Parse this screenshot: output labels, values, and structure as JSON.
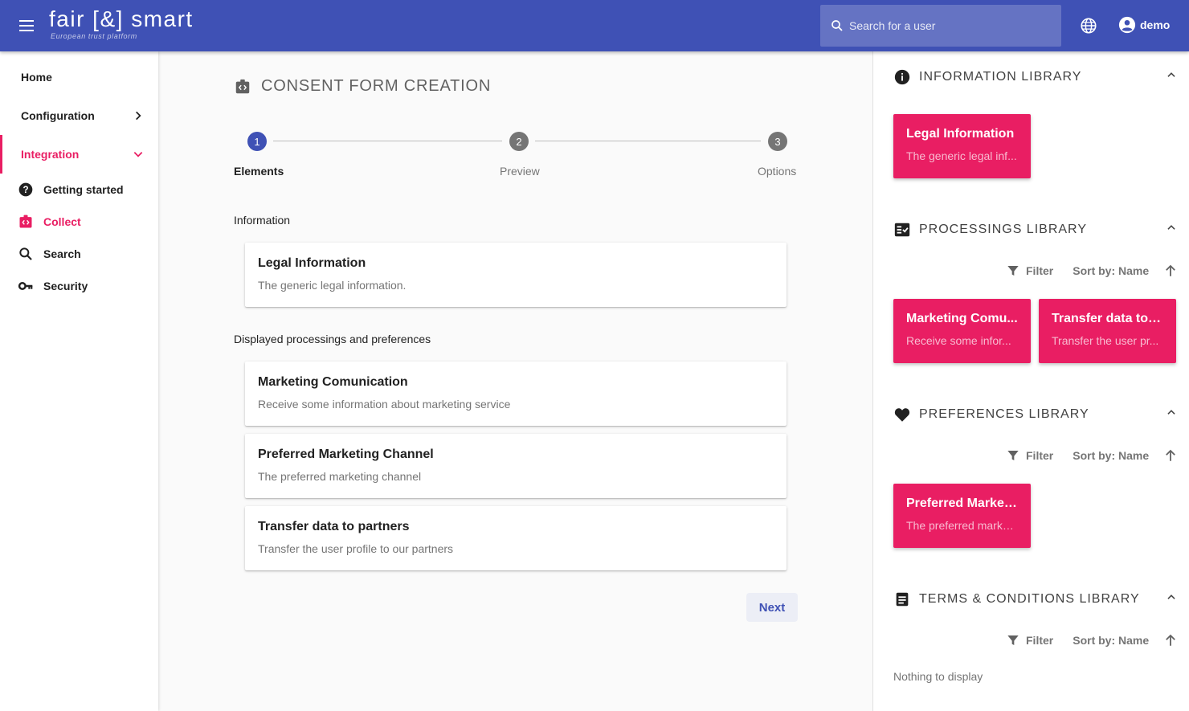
{
  "header": {
    "logo": "fair [&] smart",
    "tagline": "European trust platform",
    "search_placeholder": "Search for a user",
    "user": "demo"
  },
  "sidebar": {
    "items": [
      {
        "label": "Home"
      },
      {
        "label": "Configuration"
      },
      {
        "label": "Integration"
      }
    ],
    "subitems": [
      {
        "label": "Getting started",
        "icon": "help-circle-icon"
      },
      {
        "label": "Collect",
        "icon": "collect-icon"
      },
      {
        "label": "Search",
        "icon": "search-icon"
      },
      {
        "label": "Security",
        "icon": "key-icon"
      }
    ]
  },
  "main": {
    "title": "CONSENT FORM CREATION",
    "steps": [
      {
        "number": "1",
        "label": "Elements"
      },
      {
        "number": "2",
        "label": "Preview"
      },
      {
        "number": "3",
        "label": "Options"
      }
    ],
    "sections": {
      "information": "Information",
      "processings": "Displayed processings and preferences"
    },
    "cards": [
      {
        "title": "Legal Information",
        "desc": "The generic legal information."
      },
      {
        "title": "Marketing Comunication",
        "desc": "Receive some information about marketing service"
      },
      {
        "title": "Preferred Marketing Channel",
        "desc": "The preferred marketing channel"
      },
      {
        "title": "Transfer data to partners",
        "desc": "Transfer the user profile to our partners"
      }
    ],
    "next_label": "Next"
  },
  "right_panel": {
    "libraries": [
      {
        "title": "INFORMATION LIBRARY",
        "icon": "info-icon"
      },
      {
        "title": "PROCESSINGS LIBRARY",
        "icon": "checklist-icon"
      },
      {
        "title": "PREFERENCES LIBRARY",
        "icon": "heart-icon"
      },
      {
        "title": "TERMS & CONDITIONS LIBRARY",
        "icon": "document-icon"
      }
    ],
    "filter_label": "Filter",
    "sort_label": "Sort by: Name",
    "info_cards": [
      {
        "title": "Legal Information",
        "desc": "The generic legal inf..."
      }
    ],
    "processing_cards": [
      {
        "title": "Marketing Comu...",
        "desc": "Receive some infor..."
      },
      {
        "title": "Transfer data to p...",
        "desc": "Transfer the user pr..."
      }
    ],
    "preference_cards": [
      {
        "title": "Preferred Marketi...",
        "desc": "The preferred marke..."
      }
    ],
    "empty_text": "Nothing to display"
  },
  "colors": {
    "primary": "#3f51b5",
    "accent": "#e91e63"
  }
}
